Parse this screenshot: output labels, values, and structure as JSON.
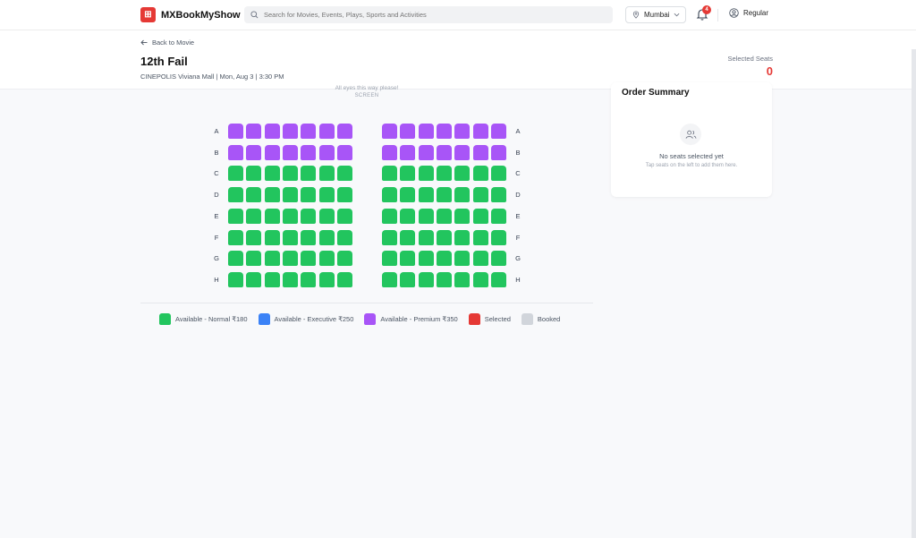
{
  "nav": {
    "brand": "MXBookMyShow",
    "logo_glyph": "⊞",
    "search_placeholder": "Search for Movies, Events, Plays, Sports and Activities",
    "city": "Mumbai",
    "notification_count": "4",
    "user": "Regular"
  },
  "header": {
    "back": "Back to Movie",
    "title": "12th Fail",
    "meta": "CINEPOLIS Viviana Mall | Mon, Aug 3 | 3:30 PM",
    "selected_label": "Selected Seats",
    "selected_count": "0"
  },
  "screen": {
    "hint": "All eyes this way please!",
    "label": "SCREEN"
  },
  "seat_map": {
    "rows": [
      "A",
      "B",
      "C",
      "D",
      "E",
      "F",
      "G",
      "H"
    ],
    "row_types": [
      "premium",
      "premium",
      "normal",
      "normal",
      "normal",
      "normal",
      "normal",
      "normal"
    ],
    "seats_per_block": 7,
    "blocks": 2,
    "colors": {
      "normal": "#22c55e",
      "executive": "#3b82f6",
      "premium": "#a855f7",
      "selected": "#e53935",
      "booked": "#d1d5db"
    }
  },
  "legend": [
    {
      "label": "Available - Normal ₹180",
      "color": "#22c55e"
    },
    {
      "label": "Available - Executive ₹250",
      "color": "#3b82f6"
    },
    {
      "label": "Available - Premium ₹350",
      "color": "#a855f7"
    },
    {
      "label": "Selected",
      "color": "#e53935"
    },
    {
      "label": "Booked",
      "color": "#d1d5db"
    }
  ],
  "summary": {
    "title": "Order Summary",
    "empty": "No seats selected yet",
    "hint": "Tap seats on the left to add them here."
  }
}
